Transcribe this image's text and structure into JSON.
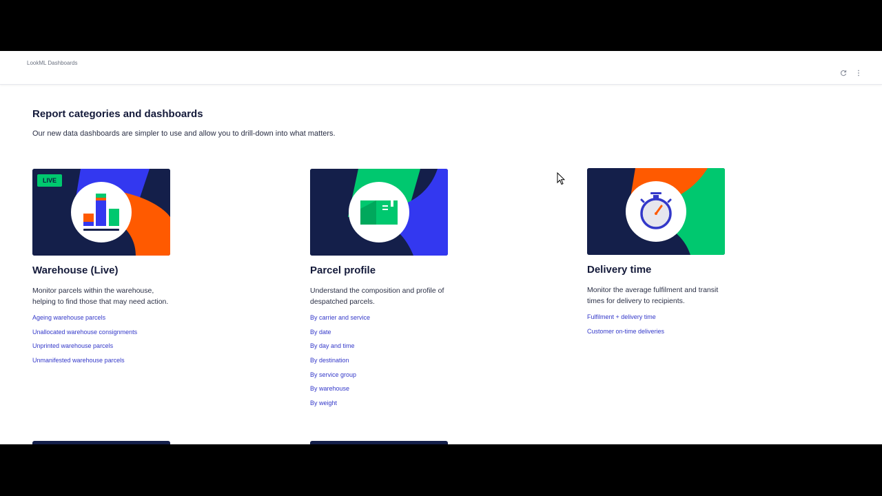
{
  "topbar": {
    "breadcrumb": "LookML Dashboards",
    "refresh_icon": "refresh-icon",
    "menu_icon": "more-vertical-icon"
  },
  "page": {
    "title": "Report categories and dashboards",
    "subtitle": "Our new data dashboards are simpler to use and allow you to drill-down into what matters."
  },
  "colors": {
    "navy": "#141f4a",
    "orange": "#ff5a00",
    "blue": "#3338f0",
    "green": "#00c86f",
    "link": "#3338c9"
  },
  "cards": [
    {
      "badge": "LIVE",
      "title": "Warehouse (Live)",
      "description": "Monitor parcels within the warehouse, helping to find those that may need action.",
      "illustration": "bar-chart-icon",
      "links": [
        "Ageing warehouse parcels",
        "Unallocated warehouse consignments",
        "Unprinted warehouse parcels",
        "Unmanifested warehouse parcels"
      ]
    },
    {
      "title": "Parcel profile",
      "description": "Understand the composition and profile of despatched parcels.",
      "illustration": "parcel-icon",
      "links": [
        "By carrier and service",
        "By date",
        "By day and time",
        "By destination",
        "By service group",
        "By warehouse",
        "By weight"
      ]
    },
    {
      "title": "Delivery time",
      "description": "Monitor the average fulfilment and transit times for delivery to recipients.",
      "illustration": "stopwatch-icon",
      "links": [
        "Fulfilment + delivery time",
        "Customer on-time deliveries"
      ]
    }
  ]
}
